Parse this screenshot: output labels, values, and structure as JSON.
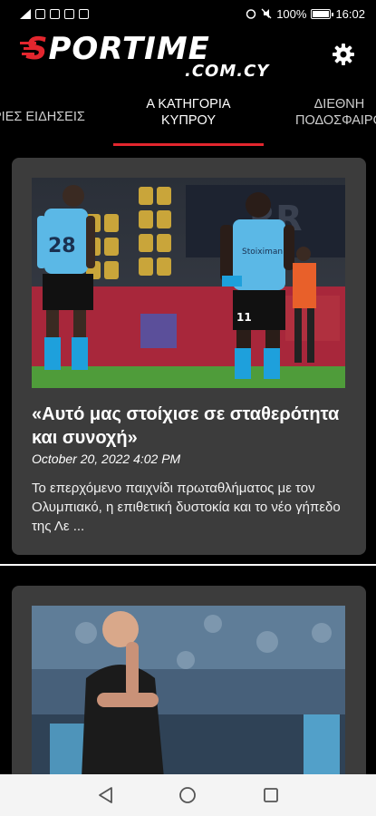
{
  "status_bar": {
    "battery": "100%",
    "time": "16:02"
  },
  "header": {
    "logo_main_prefix": "S",
    "logo_main_rest": "PORTIME",
    "logo_sub": ".COM.CY"
  },
  "tabs": [
    {
      "label": "ΡΙΕΣ ΕΙΔΗΣΕΙΣ",
      "active": false
    },
    {
      "label": "Α ΚΑΤΗΓΟΡΙΑ\nΚΥΠΡΟΥ",
      "active": true
    },
    {
      "label": "ΔΙΕΘΝΗ\nΠΟΔΟΣΦΑΙΡΟ",
      "active": false
    }
  ],
  "articles": [
    {
      "title": "«Αυτό μας στοίχισε σε σταθερότητα και συνοχή»",
      "date": "October 20, 2022 4:02 PM",
      "excerpt": "Το επερχόμενο παιχνίδι πρωταθλήματος με τον Ολυμπιακό, η επιθετική δυστοκία και το νέο γήπεδο της Λε ...",
      "image_desc": "football-players-photo",
      "jersey_numbers": [
        "28",
        "11"
      ]
    },
    {
      "title": "",
      "image_desc": "coach-photo"
    }
  ],
  "colors": {
    "accent": "#e3262e",
    "card_bg": "#3c3c3c",
    "background": "#000000",
    "jersey": "#5bb8e6"
  },
  "icons": {
    "settings": "gear-icon",
    "nav_back": "back-triangle-icon",
    "nav_home": "home-circle-icon",
    "nav_recent": "recents-square-icon"
  }
}
